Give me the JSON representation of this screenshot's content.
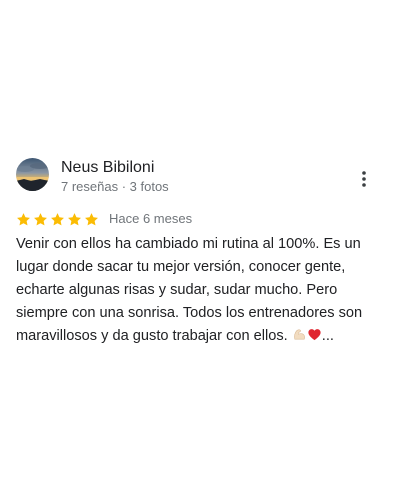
{
  "review": {
    "author": {
      "name": "Neus Bibiloni",
      "meta": "7 reseñas · 3 fotos"
    },
    "rating": 5,
    "rating_max": 5,
    "star_color": "#fbbc04",
    "date": "Hace 6 meses",
    "text_lines": [
      "Venir con ellos ha cambiado mi rutina al 100%. Es un",
      "lugar donde sacar tu mejor versión, conocer gente,",
      "echarte algunas risas y sudar, sudar mucho. Pero",
      "siempre con una sonrisa. Todos los entrenadores son",
      "maravillosos y da gusto trabajar con ellos. "
    ],
    "text_emojis": [
      "flexed-biceps-icon",
      "red-heart-icon"
    ],
    "text_ellipsis": "..."
  }
}
